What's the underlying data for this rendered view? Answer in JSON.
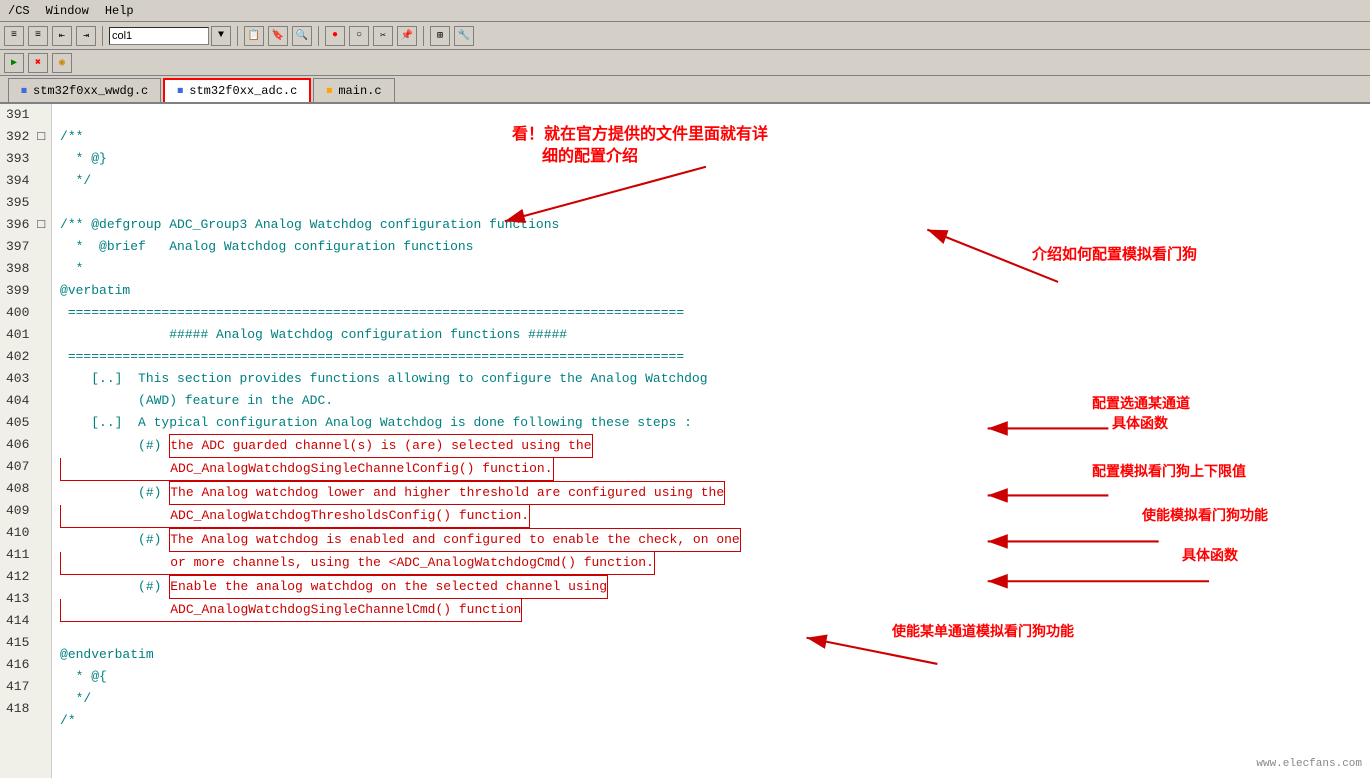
{
  "window": {
    "title": "/CS - Window - Help",
    "menu_items": [
      "/CS",
      "Window",
      "Help"
    ]
  },
  "toolbar": {
    "input_value": "col1",
    "buttons": [
      "indent1",
      "indent2",
      "indent3",
      "indent4",
      "col1-dropdown",
      "btn1",
      "btn2",
      "btn3",
      "search",
      "record",
      "circle",
      "scissors",
      "clipboard",
      "grid",
      "settings"
    ]
  },
  "toolbar2": {
    "buttons": [
      "green-arrow",
      "red-x",
      "yellow-circle"
    ]
  },
  "tabs": [
    {
      "label": "stm32f0xx_wwdg.c",
      "active": false
    },
    {
      "label": "stm32f0xx_adc.c",
      "active": true
    },
    {
      "label": "main.c",
      "active": false
    }
  ],
  "code": {
    "lines": [
      {
        "num": "391",
        "content": ""
      },
      {
        "num": "392",
        "expand": "□",
        "content": "/**"
      },
      {
        "num": "393",
        "content": "  * @}"
      },
      {
        "num": "394",
        "content": "  */"
      },
      {
        "num": "395",
        "content": ""
      },
      {
        "num": "396",
        "expand": "□",
        "content": "/** @defgroup ADC_Group3 Analog Watchdog configuration functions"
      },
      {
        "num": "397",
        "content": "  *  @brief   Analog Watchdog configuration functions"
      },
      {
        "num": "398",
        "content": "  *"
      },
      {
        "num": "399",
        "content": "@verbatim"
      },
      {
        "num": "400",
        "content": " ==============================================================================="
      },
      {
        "num": "401",
        "content": "              ##### Analog Watchdog configuration functions #####"
      },
      {
        "num": "402",
        "content": " ==============================================================================="
      },
      {
        "num": "403",
        "content": "    [..]  This section provides functions allowing to configure the Analog Watchdog"
      },
      {
        "num": "404",
        "content": "          (AWD) feature in the ADC."
      },
      {
        "num": "405",
        "content": "    [..]  A typical configuration Analog Watchdog is done following these steps :"
      },
      {
        "num": "406",
        "content": "          (#) the ADC guarded channel(s) is (are) selected using the"
      },
      {
        "num": "407",
        "content": "              ADC_AnalogWatchdogSingleChannelConfig() function."
      },
      {
        "num": "408",
        "content": "          (#) The Analog watchdog lower and higher threshold are configured using the"
      },
      {
        "num": "409",
        "content": "              ADC_AnalogWatchdogThresholdsConfig() function."
      },
      {
        "num": "410",
        "content": "          (#) The Analog watchdog is enabled and configured to enable the check, on one"
      },
      {
        "num": "411",
        "content": "              or more channels, using the <ADC_AnalogWatchdogCmd() function."
      },
      {
        "num": "412",
        "content": "          (#) Enable the analog watchdog on the selected channel using"
      },
      {
        "num": "413",
        "content": "              ADC_AnalogWatchdogSingleChannelCmd() function"
      },
      {
        "num": "414",
        "content": ""
      },
      {
        "num": "415",
        "content": "@endverbatim"
      },
      {
        "num": "416",
        "content": "  * @{"
      },
      {
        "num": "417",
        "content": "  */"
      },
      {
        "num": "418",
        "content": "/*"
      }
    ]
  },
  "annotations": {
    "ann1": "看！就在官方提供的文件里面就有详",
    "ann2": "细的配置介绍",
    "ann3": "介绍如何配置模拟看门狗",
    "ann4": "配置选通某通道",
    "ann5": "具体函数",
    "ann6": "配置模拟看门狗上下限值",
    "ann7": "使能模拟看门狗功能",
    "ann8": "具体函数",
    "ann9": "使能某单通道模拟看门狗功能"
  },
  "watermark": "www.elecfans.com"
}
